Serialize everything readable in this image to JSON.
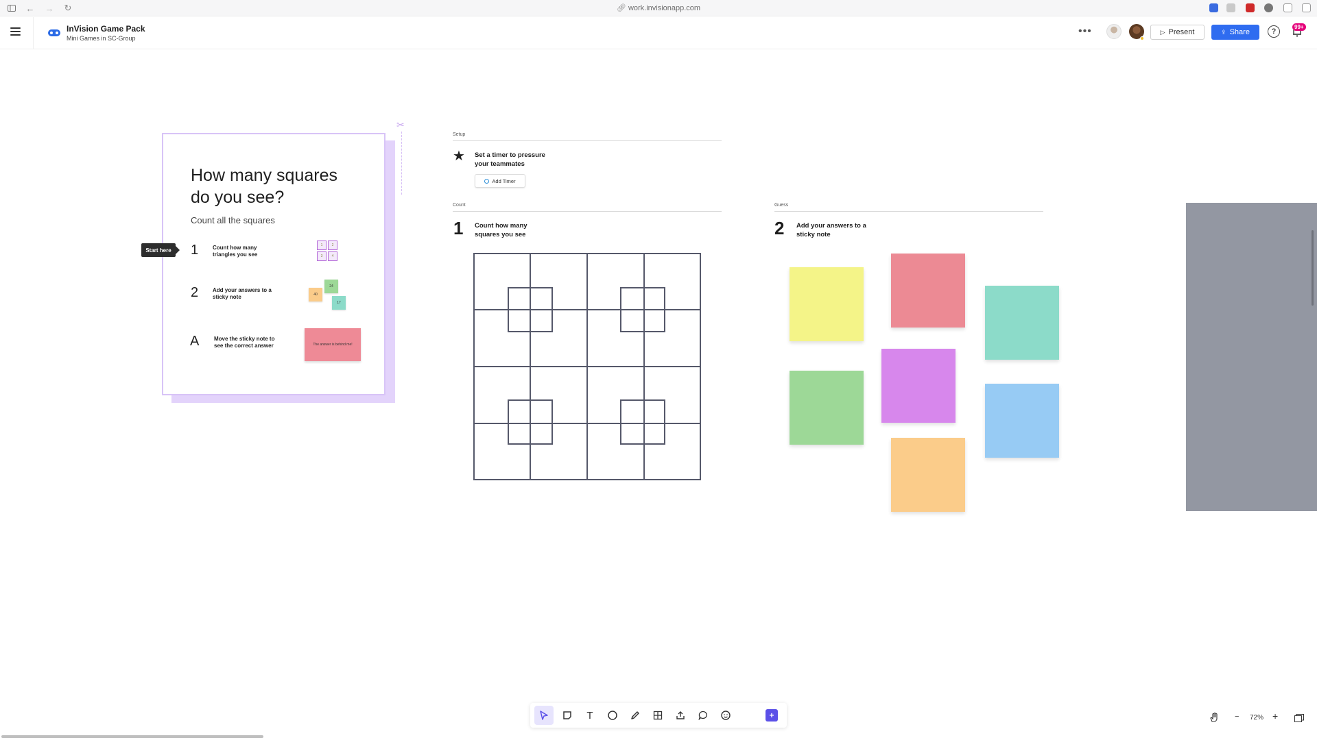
{
  "browser": {
    "url": "work.invisionapp.com"
  },
  "header": {
    "project_title": "InVision Game Pack",
    "project_subtitle": "Mini Games in SC-Group",
    "more_label": "•••",
    "present_label": "Present",
    "share_label": "Share",
    "help_label": "?",
    "notification_count": "99+"
  },
  "card": {
    "title": "How many squares do you see?",
    "subtitle": "Count all the squares",
    "start_here": "Start here",
    "steps": [
      {
        "num": "1",
        "text": "Count how many triangles you see"
      },
      {
        "num": "2",
        "text": "Add your answers to a sticky note"
      },
      {
        "num": "A",
        "text": "Move the sticky note to see the correct answer"
      }
    ],
    "mini_squares": [
      "1",
      "2",
      "3",
      "4"
    ],
    "mini_notes": [
      "24",
      "40",
      "17"
    ],
    "answer_note": "The answer is behind me!"
  },
  "setup": {
    "label": "Setup",
    "text": "Set a timer to pressure your teammates",
    "add_timer": "Add Timer"
  },
  "count": {
    "label": "Count",
    "num": "1",
    "text": "Count how many squares you see"
  },
  "guess": {
    "label": "Guess",
    "num": "2",
    "text": "Add your answers to a sticky note"
  },
  "sticky_colors": {
    "yellow": "#f4f488",
    "red": "#ec8a94",
    "teal": "#8cdbc9",
    "green": "#9dd897",
    "purple": "#d787ec",
    "blue": "#97cbf4",
    "orange": "#fbcc8a"
  },
  "toolbar": {
    "tools": [
      "select-tool",
      "sticky-note-tool",
      "text-tool",
      "shape-tool",
      "pen-tool",
      "table-tool",
      "upload-tool",
      "comment-tool",
      "sticker-tool",
      "add-tool"
    ]
  },
  "zoom": {
    "level": "72%",
    "minus": "−",
    "plus": "+"
  },
  "colors": {
    "accent": "#2f6cf0",
    "card_border": "#d8c4f7",
    "frame_gray": "#9397a2"
  }
}
